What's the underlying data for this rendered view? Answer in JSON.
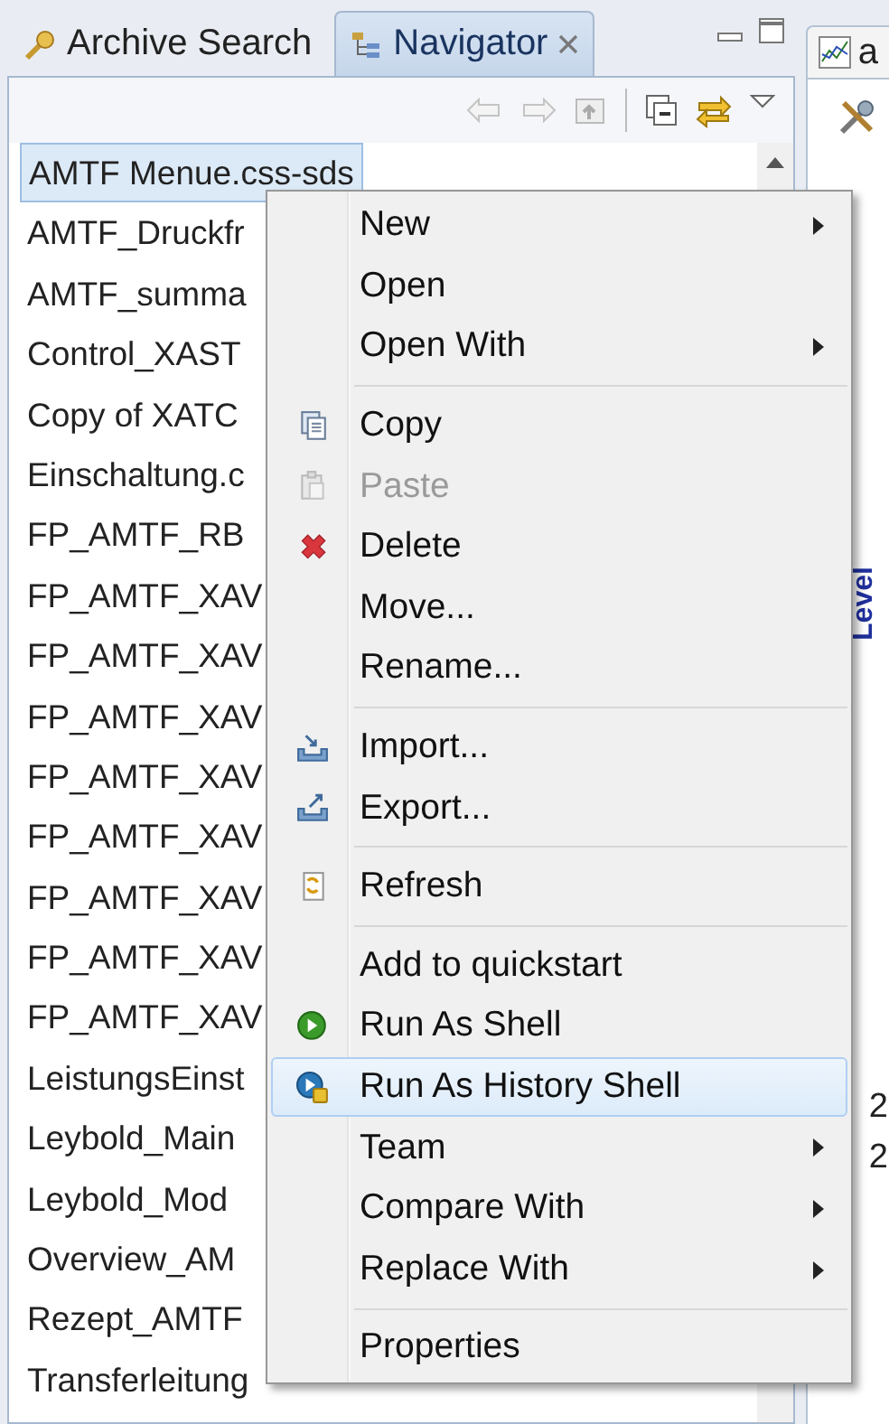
{
  "tabs": [
    {
      "label": "Archive Search",
      "selected": false,
      "closable": false
    },
    {
      "label": "Navigator",
      "selected": true,
      "closable": true
    }
  ],
  "files": [
    {
      "name": "AMTF Menue.css-sds",
      "selected": true
    },
    {
      "name": "AMTF_Druckfr",
      "selected": false
    },
    {
      "name": "AMTF_summa",
      "selected": false
    },
    {
      "name": "Control_XAST",
      "selected": false
    },
    {
      "name": "Copy of XATC",
      "selected": false
    },
    {
      "name": "Einschaltung.c",
      "selected": false
    },
    {
      "name": "FP_AMTF_RB",
      "selected": false
    },
    {
      "name": "FP_AMTF_XAV",
      "selected": false
    },
    {
      "name": "FP_AMTF_XAV",
      "selected": false
    },
    {
      "name": "FP_AMTF_XAV",
      "selected": false
    },
    {
      "name": "FP_AMTF_XAV",
      "selected": false
    },
    {
      "name": "FP_AMTF_XAV",
      "selected": false
    },
    {
      "name": "FP_AMTF_XAV",
      "selected": false
    },
    {
      "name": "FP_AMTF_XAV",
      "selected": false
    },
    {
      "name": "FP_AMTF_XAV",
      "selected": false
    },
    {
      "name": "LeistungsEinst",
      "selected": false
    },
    {
      "name": "Leybold_Main",
      "selected": false
    },
    {
      "name": "Leybold_Mod",
      "selected": false
    },
    {
      "name": "Overview_AM",
      "selected": false
    },
    {
      "name": "Rezept_AMTF",
      "selected": false
    },
    {
      "name": "Transferleitung",
      "selected": false
    }
  ],
  "context_menu": [
    {
      "kind": "plain",
      "label": "New",
      "submenu": true,
      "disabled": false,
      "selected": false
    },
    {
      "kind": "plain",
      "label": "Open",
      "submenu": false,
      "disabled": false,
      "selected": false
    },
    {
      "kind": "plain",
      "label": "Open With",
      "submenu": true,
      "disabled": false,
      "selected": false
    },
    {
      "kind": "separator"
    },
    {
      "kind": "copy",
      "label": "Copy",
      "submenu": false,
      "disabled": false,
      "selected": false
    },
    {
      "kind": "paste",
      "label": "Paste",
      "submenu": false,
      "disabled": true,
      "selected": false
    },
    {
      "kind": "delete",
      "label": "Delete",
      "submenu": false,
      "disabled": false,
      "selected": false
    },
    {
      "kind": "plain",
      "label": "Move...",
      "submenu": false,
      "disabled": false,
      "selected": false
    },
    {
      "kind": "plain",
      "label": "Rename...",
      "submenu": false,
      "disabled": false,
      "selected": false
    },
    {
      "kind": "separator"
    },
    {
      "kind": "import",
      "label": "Import...",
      "submenu": false,
      "disabled": false,
      "selected": false
    },
    {
      "kind": "export",
      "label": "Export...",
      "submenu": false,
      "disabled": false,
      "selected": false
    },
    {
      "kind": "separator"
    },
    {
      "kind": "refresh",
      "label": "Refresh",
      "submenu": false,
      "disabled": false,
      "selected": false
    },
    {
      "kind": "separator"
    },
    {
      "kind": "plain",
      "label": "Add to quickstart",
      "submenu": false,
      "disabled": false,
      "selected": false
    },
    {
      "kind": "run",
      "label": "Run As Shell",
      "submenu": false,
      "disabled": false,
      "selected": false
    },
    {
      "kind": "history",
      "label": "Run As History Shell",
      "submenu": false,
      "disabled": false,
      "selected": true
    },
    {
      "kind": "plain",
      "label": "Team",
      "submenu": true,
      "disabled": false,
      "selected": false
    },
    {
      "kind": "plain",
      "label": "Compare With",
      "submenu": true,
      "disabled": false,
      "selected": false
    },
    {
      "kind": "plain",
      "label": "Replace With",
      "submenu": true,
      "disabled": false,
      "selected": false
    },
    {
      "kind": "separator"
    },
    {
      "kind": "plain",
      "label": "Properties",
      "submenu": false,
      "disabled": false,
      "selected": false
    }
  ],
  "right_panel": {
    "tab": {
      "label": "a",
      "selected": false
    },
    "axis_label": "Level",
    "values": [
      "2",
      "2"
    ]
  }
}
